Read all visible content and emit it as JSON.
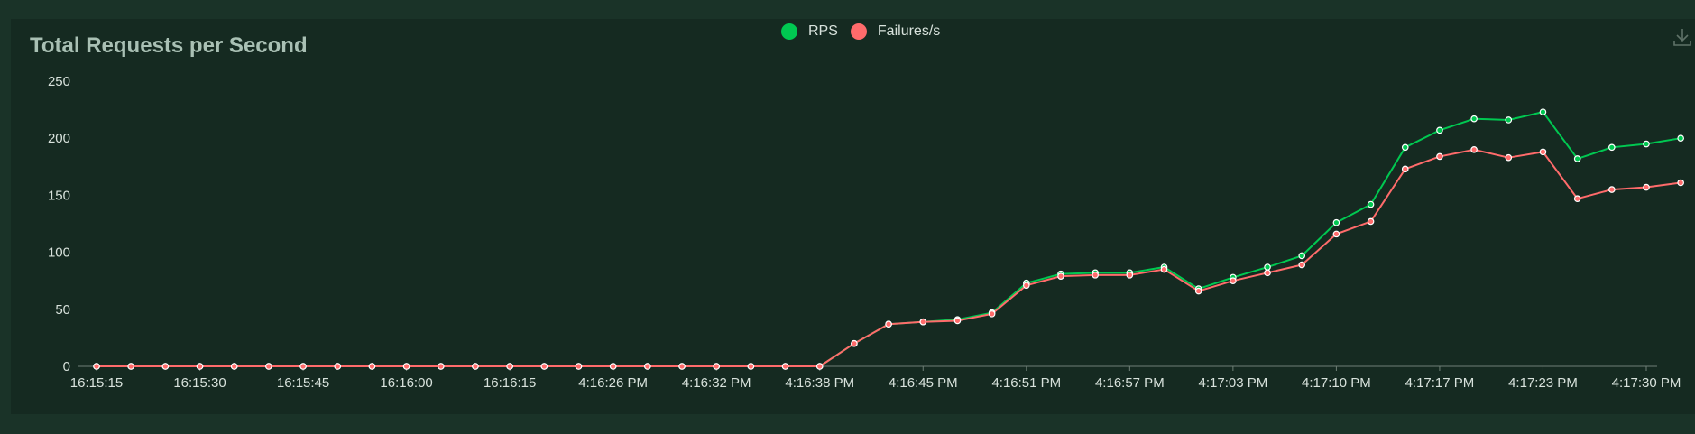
{
  "chart_data": {
    "type": "line",
    "title": "Total Requests per Second",
    "xlabel": "",
    "ylabel": "",
    "ylim": [
      0,
      250
    ],
    "yticks": [
      0,
      50,
      100,
      150,
      200,
      250
    ],
    "grid": false,
    "legend_position": "top-center",
    "x": [
      "16:15:15",
      "",
      "",
      "16:15:30",
      "",
      "",
      "16:15:45",
      "",
      "",
      "16:16:00",
      "",
      "",
      "16:16:15",
      "",
      "",
      "4:16:26 PM",
      "",
      "",
      "4:16:32 PM",
      "",
      "",
      "4:16:38 PM",
      "",
      "",
      "4:16:45 PM",
      "",
      "",
      "4:16:51 PM",
      "",
      "",
      "4:16:57 PM",
      "",
      "",
      "4:17:03 PM",
      "",
      "",
      "4:17:10 PM",
      "",
      "",
      "4:17:17 PM",
      "",
      "",
      "4:17:23 PM",
      "",
      "",
      "4:17:30 PM"
    ],
    "series": [
      {
        "name": "RPS",
        "color": "#00c851",
        "values": [
          0,
          0,
          0,
          0,
          0,
          0,
          0,
          0,
          0,
          0,
          0,
          0,
          0,
          0,
          0,
          0,
          0,
          0,
          0,
          0,
          0,
          0,
          20,
          37,
          39,
          41,
          47,
          73,
          81,
          82,
          82,
          87,
          68,
          78,
          87,
          97,
          126,
          142,
          192,
          207,
          217,
          216,
          223,
          182,
          192,
          195,
          200
        ]
      },
      {
        "name": "Failures/s",
        "color": "#ff6b6b",
        "values": [
          0,
          0,
          0,
          0,
          0,
          0,
          0,
          0,
          0,
          0,
          0,
          0,
          0,
          0,
          0,
          0,
          0,
          0,
          0,
          0,
          0,
          0,
          20,
          37,
          39,
          40,
          46,
          71,
          79,
          80,
          80,
          85,
          66,
          75,
          82,
          89,
          116,
          127,
          173,
          184,
          190,
          183,
          188,
          147,
          155,
          157,
          161
        ]
      }
    ]
  },
  "toolbar": {
    "download_icon": "download-icon"
  }
}
